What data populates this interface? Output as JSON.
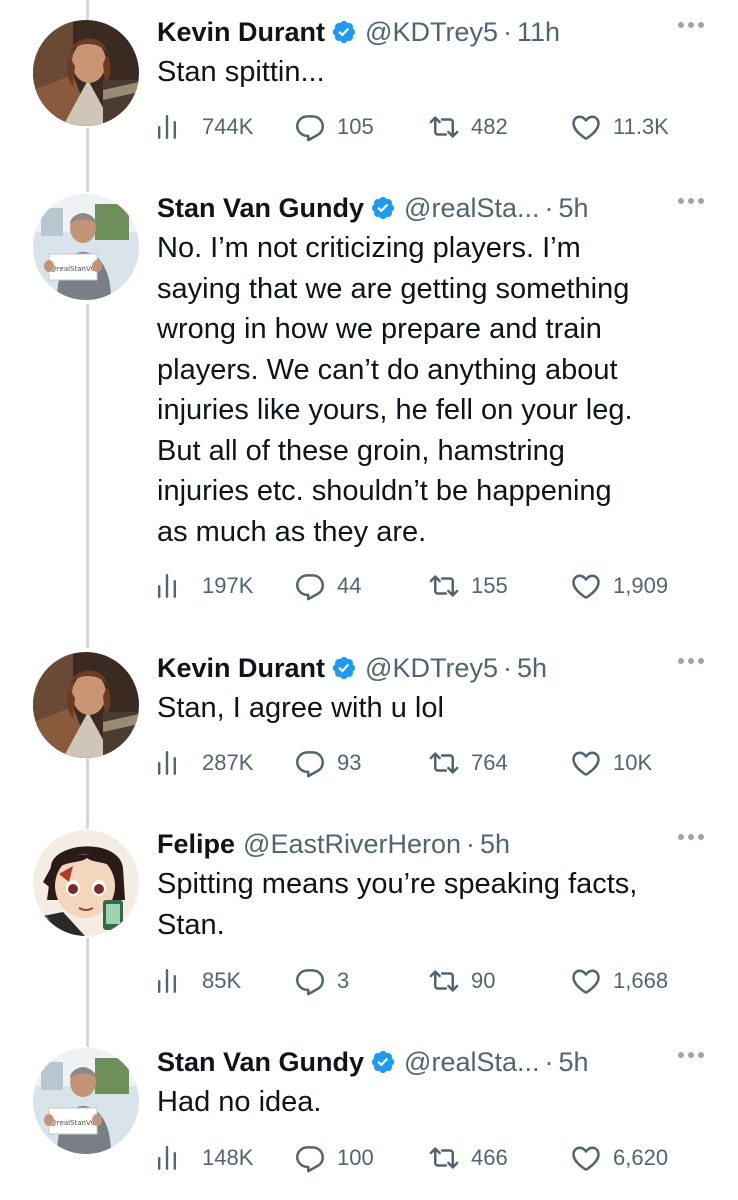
{
  "tweets": [
    {
      "name": "Kevin Durant",
      "handle": "@KDTrey5",
      "time": "11h",
      "text": "Stan spittin...",
      "views": "744K",
      "replies": "105",
      "retweets": "482",
      "likes": "11.3K",
      "verified": true
    },
    {
      "name": "Stan Van Gundy",
      "handle": "@realSta...",
      "time": "5h",
      "text": "No. I’m not criticizing players. I’m\nsaying that we are getting something\nwrong in how we prepare and train\nplayers. We can’t do anything about\ninjuries like yours, he fell on your leg.\nBut all of these groin, hamstring\ninjuries etc. shouldn’t be happening\nas much as they are.",
      "views": "197K",
      "replies": "44",
      "retweets": "155",
      "likes": "1,909",
      "verified": true
    },
    {
      "name": "Kevin Durant",
      "handle": "@KDTrey5",
      "time": "5h",
      "text": "Stan, I agree with u lol",
      "views": "287K",
      "replies": "93",
      "retweets": "764",
      "likes": "10K",
      "verified": true
    },
    {
      "name": "Felipe",
      "handle": "@EastRiverHeron",
      "time": "5h",
      "text": "Spitting means you’re speaking facts,\nStan.",
      "views": "85K",
      "replies": "3",
      "retweets": "90",
      "likes": "1,668",
      "verified": false
    },
    {
      "name": "Stan Van Gundy",
      "handle": "@realSta...",
      "time": "5h",
      "text": "Had no idea.",
      "views": "148K",
      "replies": "100",
      "retweets": "466",
      "likes": "6,620",
      "verified": true
    }
  ],
  "avatar_sign_text": "@realStanVG",
  "colors": {
    "verified": "#1d9bf0",
    "secondary_text": "#536471",
    "thread_line": "#cfd9de"
  },
  "icons": [
    "views-icon",
    "reply-icon",
    "retweet-icon",
    "like-icon",
    "verified-badge-icon",
    "more-icon"
  ]
}
